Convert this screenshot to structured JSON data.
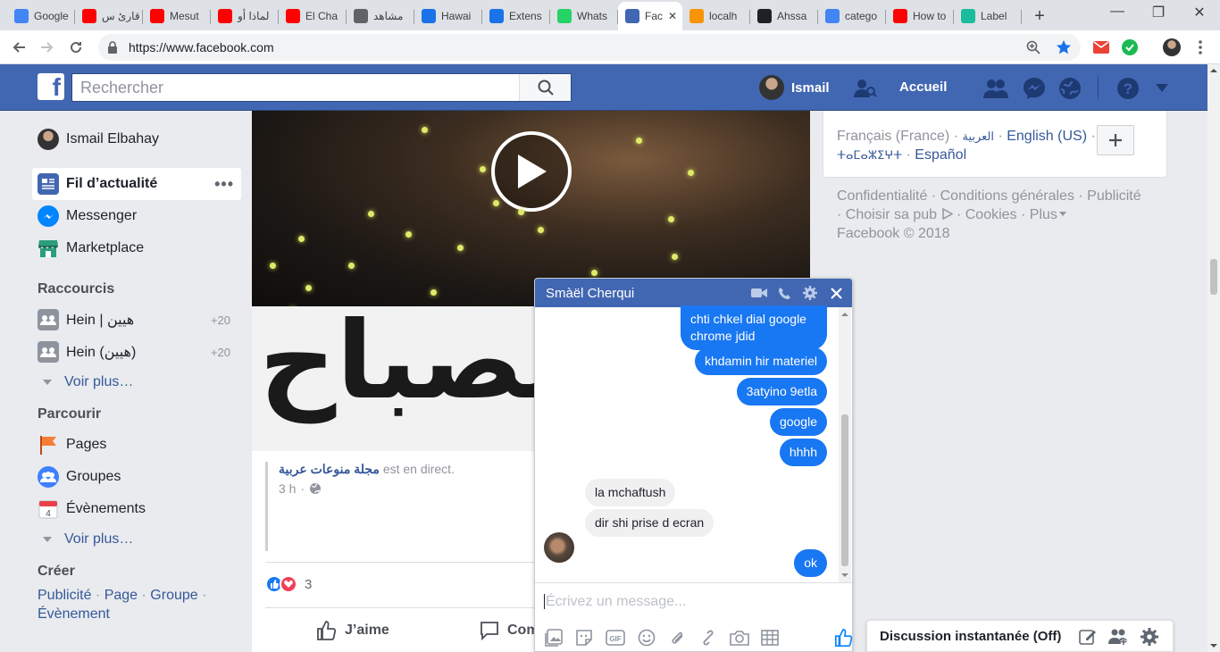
{
  "browser": {
    "tabs": [
      {
        "title": "Google",
        "favicon": "google-docs-icon",
        "color": "#4285f4"
      },
      {
        "title": "قارئ س",
        "favicon": "youtube-icon",
        "color": "#ff0000"
      },
      {
        "title": "Mesut",
        "favicon": "youtube-icon",
        "color": "#ff0000"
      },
      {
        "title": "لماذا أو",
        "favicon": "youtube-icon",
        "color": "#ff0000"
      },
      {
        "title": "El Cha",
        "favicon": "youtube-icon",
        "color": "#ff0000"
      },
      {
        "title": "مشاهد",
        "favicon": "page-icon",
        "color": "#5f6368"
      },
      {
        "title": "Hawai",
        "favicon": "clock-icon",
        "color": "#1a73e8"
      },
      {
        "title": "Extens",
        "favicon": "puzzle-icon",
        "color": "#1a73e8"
      },
      {
        "title": "Whats",
        "favicon": "whatsapp-icon",
        "color": "#25d366"
      },
      {
        "title": "Fac",
        "favicon": "facebook-icon",
        "color": "#4267b2",
        "active": true
      },
      {
        "title": "localh",
        "favicon": "phpmyadmin-icon",
        "color": "#f89406"
      },
      {
        "title": "Ahssa",
        "favicon": "home-icon",
        "color": "#202124"
      },
      {
        "title": "catego",
        "favicon": "google-icon",
        "color": "#4285f4"
      },
      {
        "title": "How to",
        "favicon": "youtube-icon",
        "color": "#ff0000"
      },
      {
        "title": "Label",
        "favicon": "s-icon",
        "color": "#1abc9c"
      }
    ],
    "url": "https://www.facebook.com"
  },
  "fb": {
    "search_placeholder": "Rechercher",
    "user_short": "Ismail",
    "home": "Accueil"
  },
  "sidebar": {
    "profile": "Ismail Elbahay",
    "items": [
      {
        "label": "Fil d’actualité"
      },
      {
        "label": "Messenger"
      },
      {
        "label": "Marketplace"
      }
    ],
    "shortcuts_title": "Raccourcis",
    "shortcuts": [
      {
        "label": "Hein | هيين",
        "count": "+20"
      },
      {
        "label": "Hein (هيين)",
        "count": "+20"
      }
    ],
    "see_more": "Voir plus…",
    "explore_title": "Parcourir",
    "explore": [
      {
        "label": "Pages"
      },
      {
        "label": "Groupes"
      },
      {
        "label": "Évènements"
      }
    ],
    "create_title": "Créer",
    "create": [
      "Publicité",
      "Page",
      "Groupe",
      "Évènement"
    ]
  },
  "post": {
    "thumb_text": "لصباح",
    "page_name": "مجلة منوعات عربية",
    "live_text": "est en direct.",
    "time": "3 h",
    "reaction_count": "3",
    "like": "J’aime",
    "comment": "Com"
  },
  "right": {
    "languages": [
      "Français (France)",
      "العربية",
      "English (US)",
      "ⵜⴰⵎⴰⵣⵉⵖⵜ",
      "Español"
    ],
    "footer_links": [
      "Confidentialité",
      "Conditions générales",
      "Publicité",
      "Choisir sa pub",
      "Cookies",
      "Plus"
    ],
    "copyright": "Facebook © 2018"
  },
  "chat": {
    "name": "Smàël Cherqui",
    "messages": [
      {
        "from": "me",
        "text": "chti chkel dial google chrome jdid"
      },
      {
        "from": "me",
        "text": "khdamin hir materiel"
      },
      {
        "from": "me",
        "text": "3atyino 9etla"
      },
      {
        "from": "me",
        "text": "google"
      },
      {
        "from": "me",
        "text": "hhhh"
      },
      {
        "from": "them",
        "text": "la mchaftush"
      },
      {
        "from": "them",
        "text": "dir shi prise d ecran"
      },
      {
        "from": "me",
        "text": "ok"
      }
    ],
    "input_placeholder": "Écrivez un message..."
  },
  "dock": {
    "label": "Discussion instantanée (Off)"
  }
}
